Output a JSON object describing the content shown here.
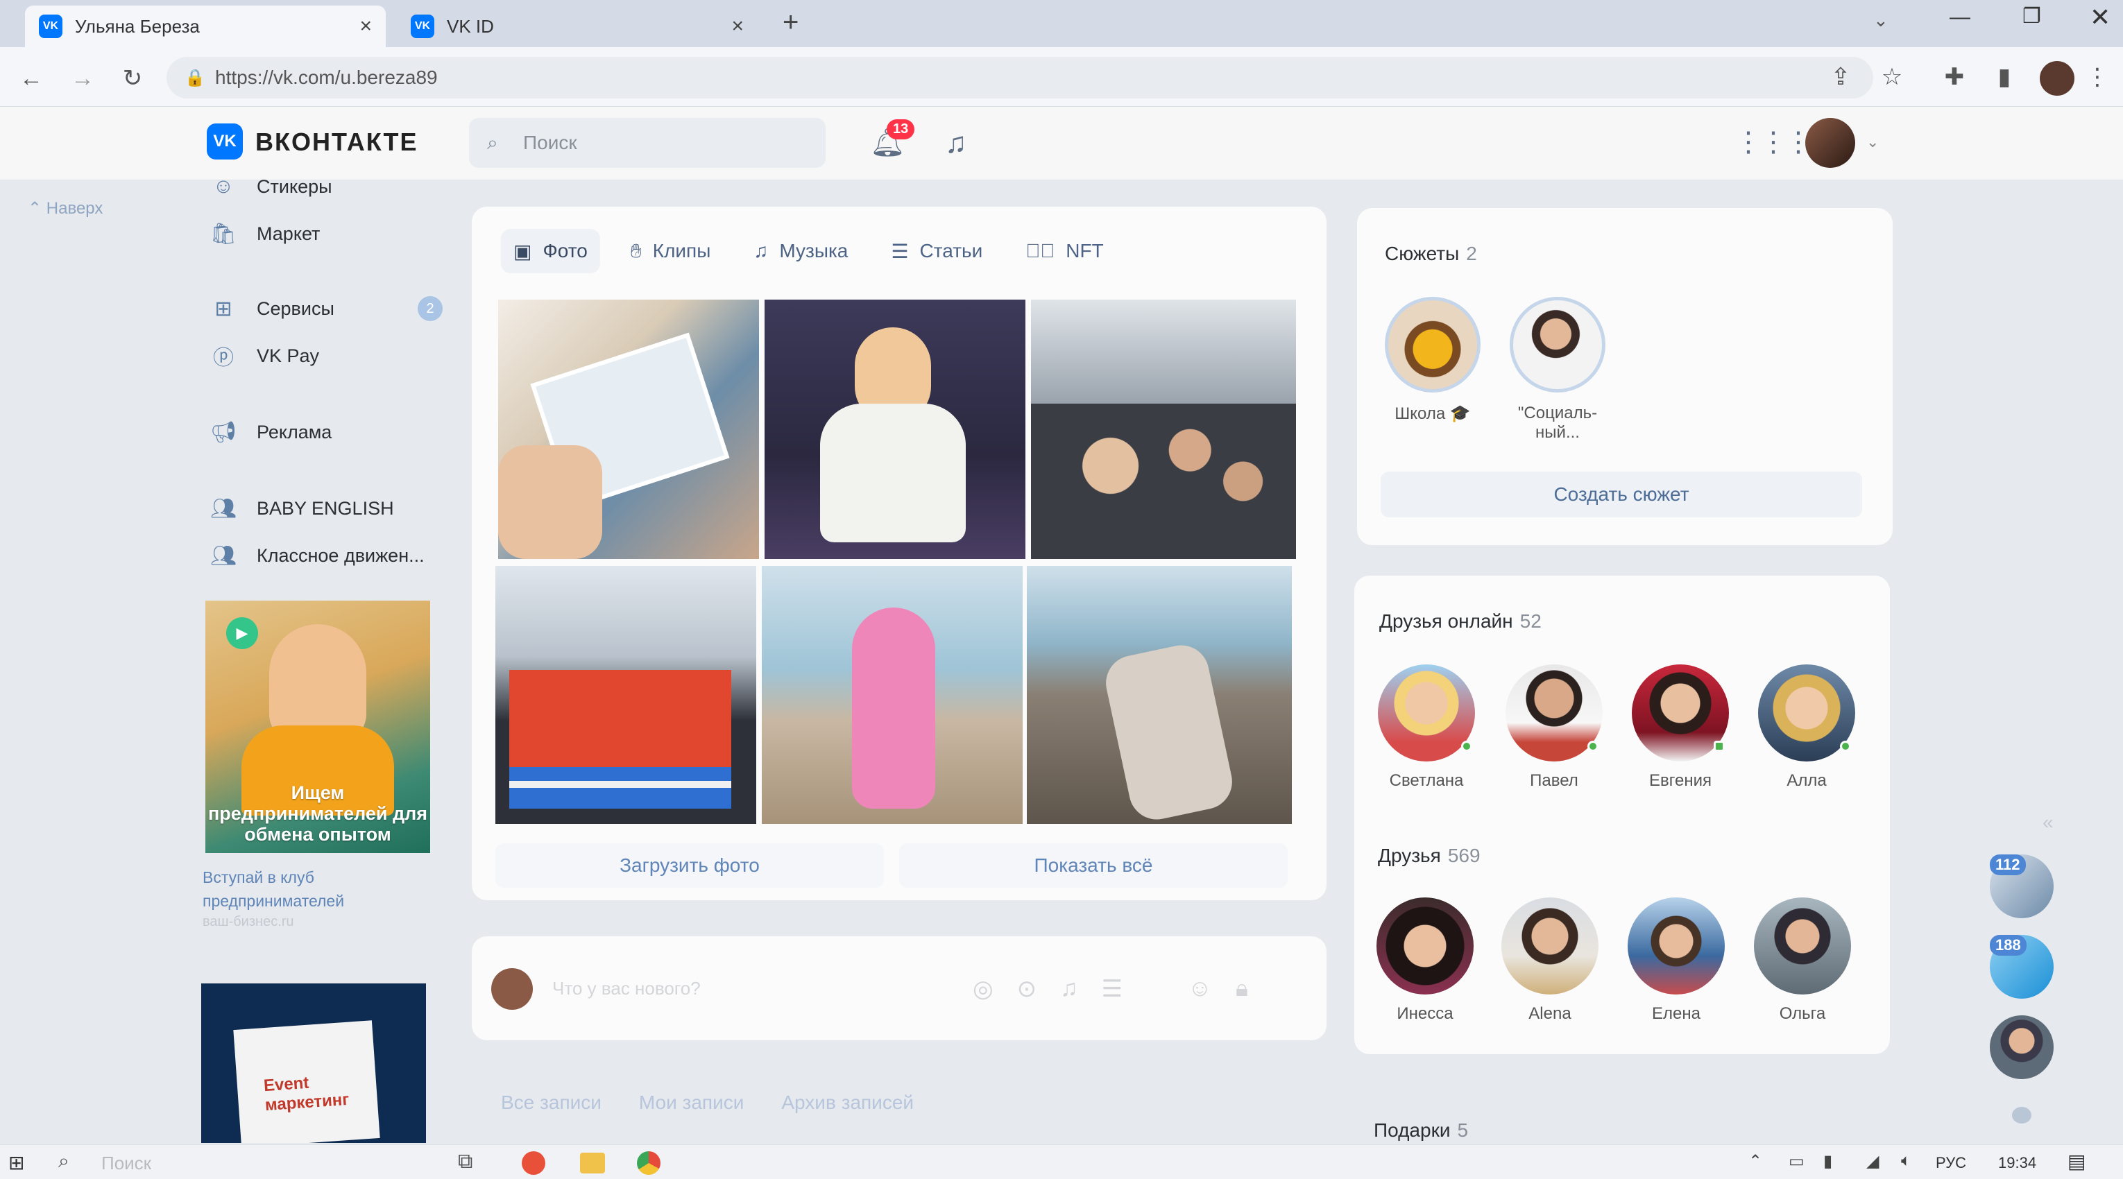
{
  "browser": {
    "tabs": [
      {
        "title": "Ульяна Береза",
        "close": "×"
      },
      {
        "title": "VK ID",
        "close": "×"
      }
    ],
    "new_tab": "+",
    "url": "https://vk.com/u.bereza89"
  },
  "header": {
    "logo_badge": "VK",
    "logo_text": "ВКОНТАКТЕ",
    "search_placeholder": "Поиск",
    "notifications_count": "13"
  },
  "back_to_top": "Наверх",
  "sidebar": {
    "items": [
      {
        "label": "Стикеры",
        "icon": "sticker-icon"
      },
      {
        "label": "Маркет",
        "icon": "bag-icon"
      },
      {
        "label": "Сервисы",
        "icon": "grid-icon",
        "badge": "2"
      },
      {
        "label": "VK Pay",
        "icon": "pay-icon"
      },
      {
        "label": "Реклама",
        "icon": "megaphone-icon"
      },
      {
        "label": "BABY ENGLISH",
        "icon": "group-icon"
      },
      {
        "label": "Классное движен...",
        "icon": "group-icon"
      }
    ],
    "promo": {
      "banner_text": "Ищем предпринимателей для обмена опытом",
      "caption": "Вступай в клуб предпринимателей",
      "sub": "ваш-бизнес.ru"
    },
    "promo2": {
      "banner_text": "Event маркетинг"
    }
  },
  "photos": {
    "tabs": [
      {
        "label": "Фото",
        "icon": "photo-icon"
      },
      {
        "label": "Клипы",
        "icon": "clip-icon"
      },
      {
        "label": "Музыка",
        "icon": "music-icon"
      },
      {
        "label": "Статьи",
        "icon": "article-icon"
      },
      {
        "label": "NFT",
        "icon": "nft-icon"
      }
    ],
    "upload_label": "Загрузить фото",
    "show_all_label": "Показать всё"
  },
  "composer": {
    "placeholder": "Что у вас нового?"
  },
  "wall_tabs": [
    "Все записи",
    "Мои записи",
    "Архив записей"
  ],
  "stories": {
    "title": "Сюжеты",
    "count": "2",
    "items": [
      {
        "name": "Школа 🎓",
        "name2": ""
      },
      {
        "name": "\"Социаль-",
        "name2": "ный..."
      }
    ],
    "create_label": "Создать сюжет"
  },
  "friends_online": {
    "title": "Друзья онлайн",
    "count": "52",
    "items": [
      "Светлана",
      "Павел",
      "Евгения",
      "Алла"
    ]
  },
  "friends": {
    "title": "Друзья",
    "count": "569",
    "items": [
      "Инесса",
      "Alena",
      "Елена",
      "Ольга"
    ]
  },
  "gifts": {
    "title": "Подарки",
    "count": "5"
  },
  "floating_chats": [
    {
      "badge": "112"
    },
    {
      "badge": "188"
    }
  ],
  "taskbar": {
    "search": "Поиск",
    "lang": "РУС",
    "time": "19:34"
  }
}
